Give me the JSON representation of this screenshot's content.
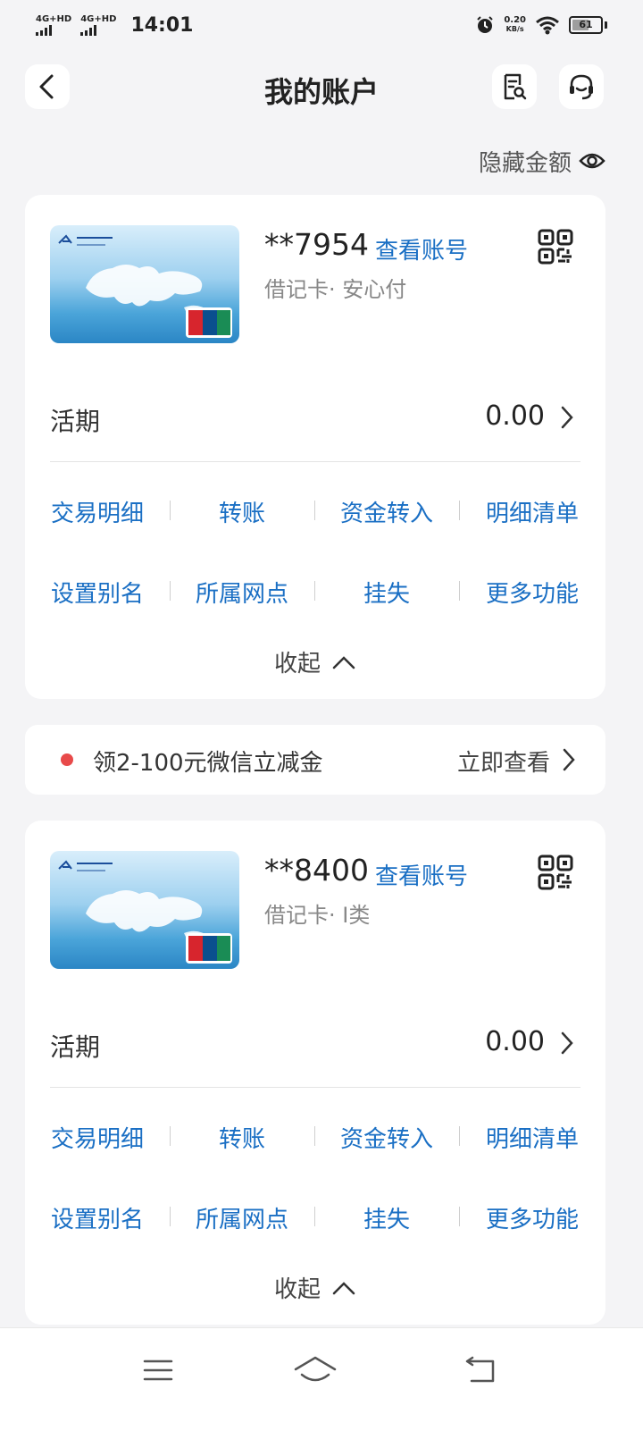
{
  "status_bar": {
    "sim1": "4G+HD",
    "sim2": "4G+HD",
    "time": "14:01",
    "net_speed_value": "0.20",
    "net_speed_unit": "KB/s",
    "battery": "61",
    "battery_level": 0.61
  },
  "header": {
    "title": "我的账户",
    "back_icon": "chevron-left-icon",
    "bill_icon": "bill-search-icon",
    "service_icon": "customer-service-icon"
  },
  "hide_amount": {
    "label": "隐藏金额",
    "icon": "eye-icon"
  },
  "accounts": [
    {
      "number": "**7954",
      "view_label": "查看账号",
      "type": "借记卡· 安心付",
      "balance_label": "活期",
      "balance": "0.00",
      "actions": [
        "交易明细",
        "转账",
        "资金转入",
        "明细清单",
        "设置别名",
        "所属网点",
        "挂失",
        "更多功能"
      ],
      "collapse_label": "收起"
    },
    {
      "number": "**8400",
      "view_label": "查看账号",
      "type": "借记卡· I类",
      "balance_label": "活期",
      "balance": "0.00",
      "actions": [
        "交易明细",
        "转账",
        "资金转入",
        "明细清单",
        "设置别名",
        "所属网点",
        "挂失",
        "更多功能"
      ],
      "collapse_label": "收起"
    }
  ],
  "promo": {
    "text": "领2-100元微信立减金",
    "cta": "立即查看"
  },
  "colors": {
    "accent": "#1a6fc4",
    "background": "#f4f4f6",
    "promo_dot": "#e84a4a"
  },
  "bottom_nav": [
    "menu-icon",
    "home-icon",
    "back-icon"
  ]
}
